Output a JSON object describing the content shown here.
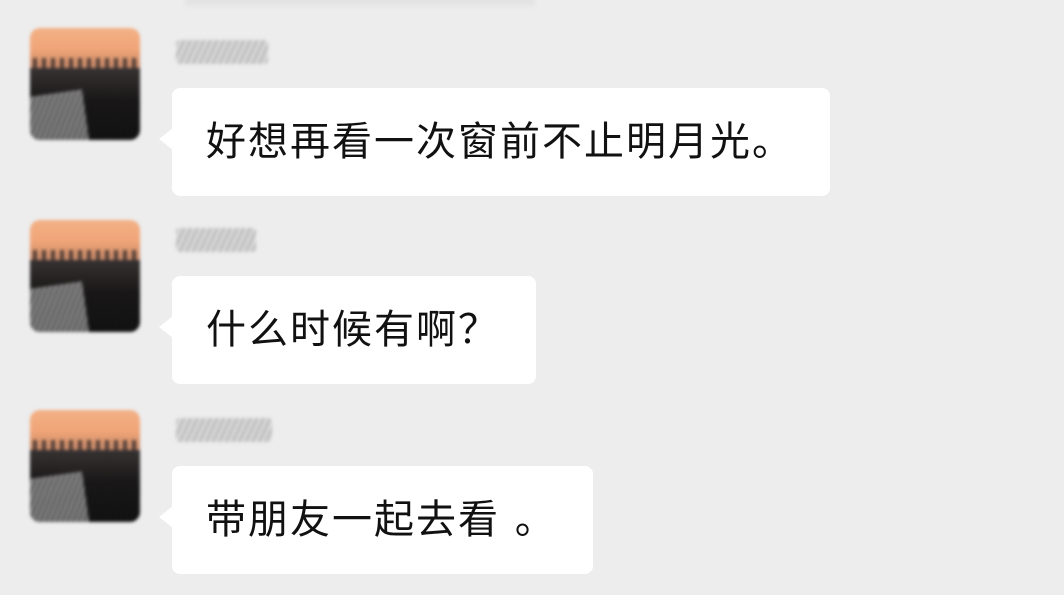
{
  "conversation": {
    "messages": [
      {
        "text": "好想再看一次窗前不止明月光。"
      },
      {
        "text": "什么时候有啊？"
      },
      {
        "text": "带朋友一起去看 。"
      }
    ]
  },
  "colors": {
    "background": "#ededed",
    "bubble": "#ffffff",
    "text": "#111111"
  },
  "icons": {
    "avatar": "avatar-image-blurred",
    "name": "sender-name-redacted"
  }
}
